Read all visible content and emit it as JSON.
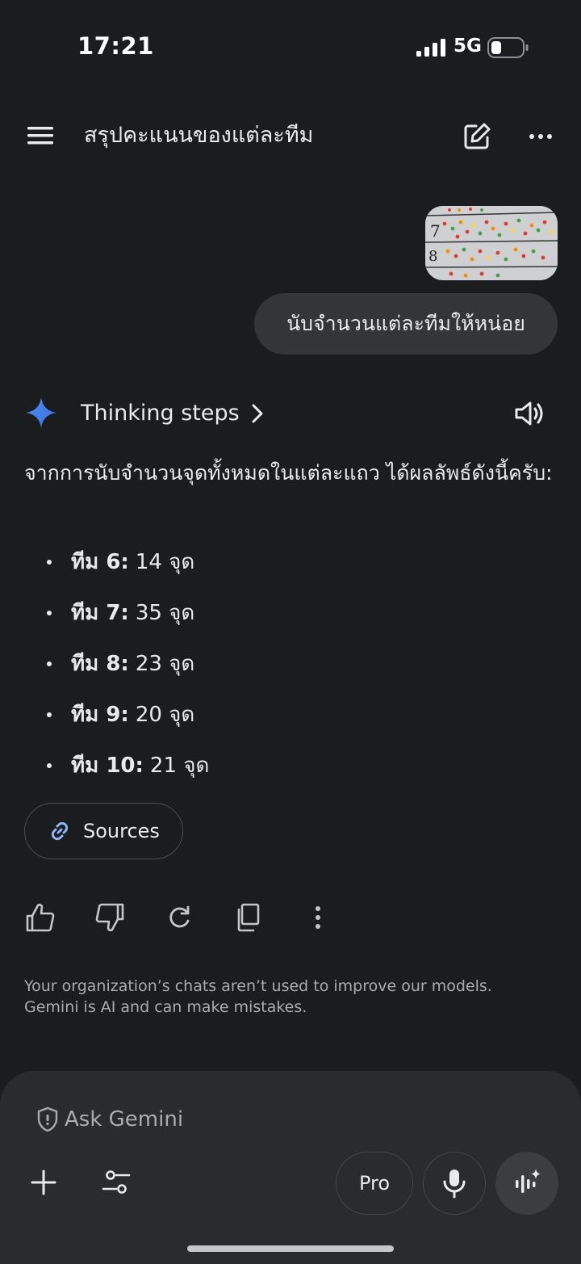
{
  "status_bar": {
    "time": "17:21",
    "network": "5G",
    "icons": [
      "signal-icon",
      "battery-icon"
    ]
  },
  "header": {
    "title": "สรุปคะแนนของแต่ละทีม",
    "icons": [
      "menu-icon",
      "edit-icon",
      "more-icon"
    ]
  },
  "user_message": {
    "attachment": "image-thumbnail",
    "text": "นับจำนวนแต่ละทีมให้หน่อย"
  },
  "response": {
    "thinking_label": "Thinking steps",
    "intro": "จากการนับจำนวนจุดทั้งหมดในแต่ละแถว ได้ผลลัพธ์ดังนี้ครับ:",
    "items": [
      {
        "label": "ทีม 6:",
        "value": "14 จุด"
      },
      {
        "label": "ทีม 7:",
        "value": "35 จุด"
      },
      {
        "label": "ทีม 8:",
        "value": "23 จุด"
      },
      {
        "label": "ทีม 9:",
        "value": "20 จุด"
      },
      {
        "label": "ทีม 10:",
        "value": "21 จุด"
      }
    ],
    "sources_label": "Sources",
    "actions": [
      "thumbs-up-icon",
      "thumbs-down-icon",
      "regenerate-icon",
      "copy-icon",
      "more-vert-icon"
    ]
  },
  "disclaimer": {
    "line1": "Your organization’s chats aren’t used to improve our models.",
    "line2": "Gemini is AI and can make mistakes."
  },
  "composer": {
    "placeholder": "Ask Gemini",
    "pro_label": "Pro",
    "icons": [
      "shield-icon",
      "plus-icon",
      "tools-icon",
      "mic-icon",
      "live-icon"
    ]
  },
  "colors": {
    "background": "#1b1c1d",
    "bubble": "#333537",
    "composer": "#2a2b2d",
    "accent_blue": "#4f8df5"
  }
}
